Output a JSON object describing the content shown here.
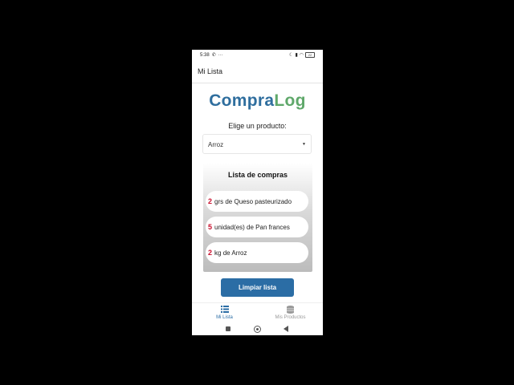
{
  "status_bar": {
    "time": "5:38",
    "battery": "22"
  },
  "header": {
    "title": "Mi Lista"
  },
  "logo": {
    "part1": "Compra",
    "part2": "Log"
  },
  "selector": {
    "prompt": "Elige un producto:",
    "selected": "Arroz"
  },
  "shopping_list": {
    "title": "Lista de compras",
    "items": [
      {
        "qty": "2",
        "text": "grs de Queso pasteurizado"
      },
      {
        "qty": "5",
        "text": "unidad(es) de Pan frances"
      },
      {
        "qty": "2",
        "text": "kg de Arroz"
      }
    ]
  },
  "clear_button": {
    "label": "Limpiar lista"
  },
  "tabs": [
    {
      "label": "Mi Lista",
      "icon": "list-icon",
      "active": true
    },
    {
      "label": "Mis Productos",
      "icon": "database-icon",
      "active": false
    }
  ],
  "colors": {
    "accent": "#2b6da5",
    "qty": "#c8102e",
    "logo_blue": "#2f6e9e",
    "logo_green": "#5fa86a"
  }
}
